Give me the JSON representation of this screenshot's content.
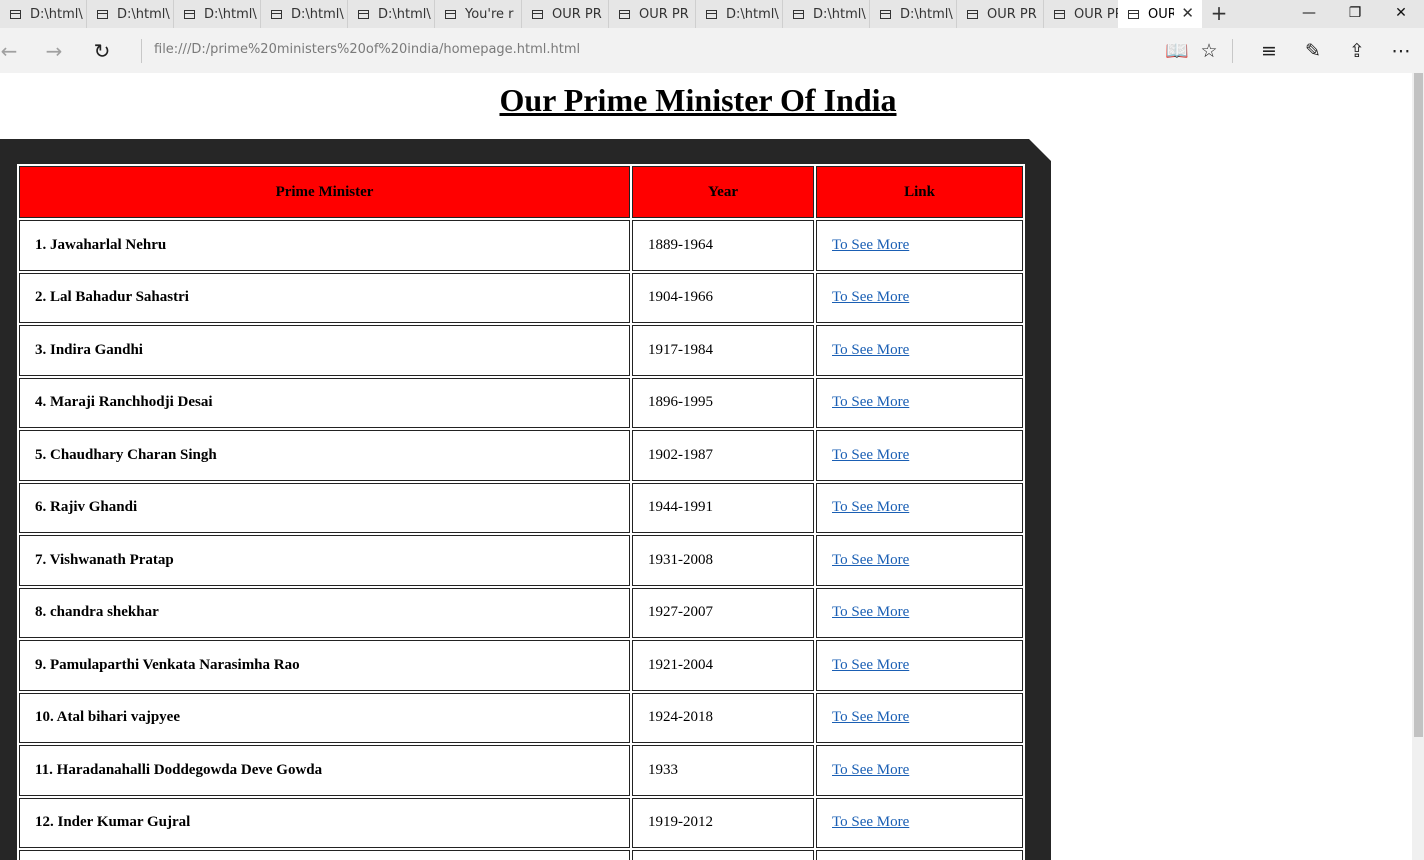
{
  "browser": {
    "tabs": [
      {
        "title": "D:\\html\\"
      },
      {
        "title": "D:\\html\\"
      },
      {
        "title": "D:\\html\\"
      },
      {
        "title": "D:\\html\\"
      },
      {
        "title": "D:\\html\\"
      },
      {
        "title": "You're r"
      },
      {
        "title": "OUR PR"
      },
      {
        "title": "OUR PR"
      },
      {
        "title": "D:\\html\\"
      },
      {
        "title": "D:\\html\\"
      },
      {
        "title": "D:\\html\\"
      },
      {
        "title": "OUR PR"
      },
      {
        "title": "OUR PR"
      },
      {
        "title": "OUR"
      }
    ],
    "tab_close_glyph": "✕",
    "new_tab_glyph": "+",
    "window_buttons": {
      "minimize": "—",
      "restore": "❐",
      "close": "✕"
    },
    "nav": {
      "back": "←",
      "forward": "→",
      "refresh": "↻"
    },
    "address": "file:///D:/prime%20ministers%20of%20india/homepage.html.html",
    "toolbar": {
      "reading_view": "📖",
      "favorite": "☆",
      "hub": "≡",
      "notes": "✎",
      "share": "⇪",
      "more": "⋯"
    }
  },
  "page": {
    "heading": "Our Prime Minister Of India",
    "table": {
      "headers": [
        "Prime Minister",
        "Year",
        "Link"
      ],
      "rows": [
        {
          "name": "1. Jawaharlal Nehru",
          "year": "1889-1964",
          "link": "To See More"
        },
        {
          "name": "2. Lal Bahadur Sahastri",
          "year": "1904-1966",
          "link": "To See More"
        },
        {
          "name": "3. Indira Gandhi",
          "year": "1917-1984",
          "link": "To See More"
        },
        {
          "name": "4. Maraji Ranchhodji Desai",
          "year": "1896-1995",
          "link": "To See More"
        },
        {
          "name": "5. Chaudhary Charan Singh",
          "year": "1902-1987",
          "link": "To See More"
        },
        {
          "name": "6. Rajiv Ghandi",
          "year": "1944-1991",
          "link": "To See More"
        },
        {
          "name": "7. Vishwanath Pratap",
          "year": "1931-2008",
          "link": "To See More"
        },
        {
          "name": "8. chandra shekhar",
          "year": "1927-2007",
          "link": "To See More"
        },
        {
          "name": "9. Pamulaparthi Venkata Narasimha Rao",
          "year": "1921-2004",
          "link": "To See More"
        },
        {
          "name": "10. Atal bihari vajpyee",
          "year": "1924-2018",
          "link": "To See More"
        },
        {
          "name": "11. Haradanahalli Doddegowda Deve Gowda",
          "year": "1933",
          "link": "To See More"
        },
        {
          "name": "12. Inder Kumar Gujral",
          "year": "1919-2012",
          "link": "To See More"
        }
      ]
    },
    "colors": {
      "header_bg": "#ff0000",
      "frame_bg": "#262626",
      "link": "#1a5fb4"
    }
  }
}
